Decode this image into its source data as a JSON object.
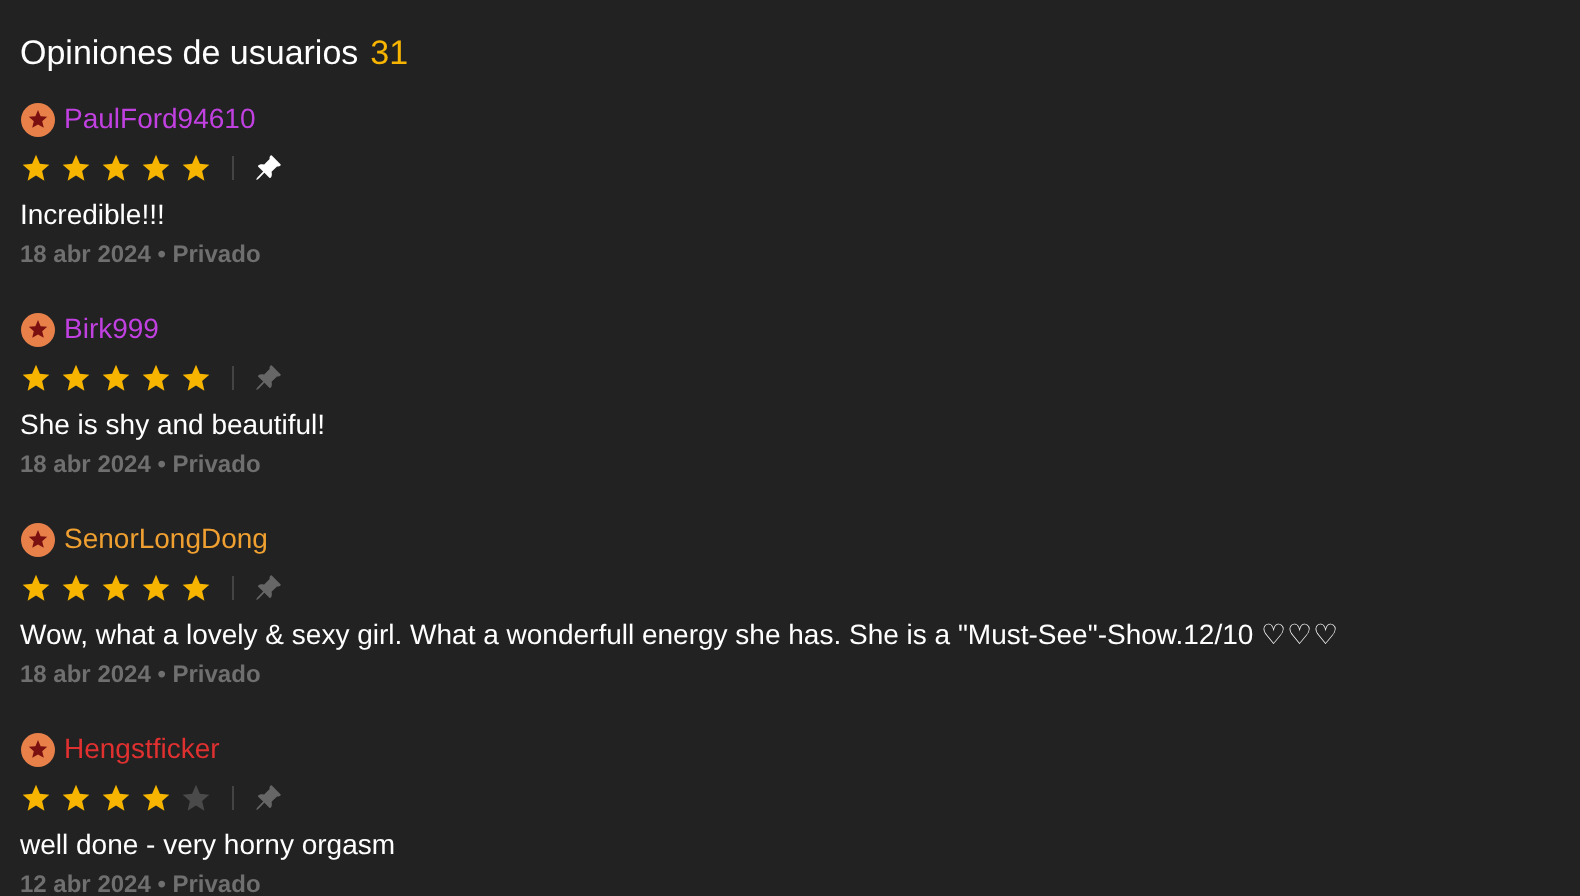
{
  "header": {
    "title": "Opiniones de usuarios",
    "count": "31"
  },
  "reviews": [
    {
      "user": "PaulFord94610",
      "color": "#c040e0",
      "stars": 5,
      "pinned": true,
      "text": "Incredible!!!",
      "meta": "18 abr 2024 • Privado"
    },
    {
      "user": "Birk999",
      "color": "#c040e0",
      "stars": 5,
      "pinned": false,
      "text": "She is shy and beautiful!",
      "meta": "18 abr 2024 • Privado"
    },
    {
      "user": "SenorLongDong",
      "color": "#f0a030",
      "stars": 5,
      "pinned": false,
      "text": "Wow, what a lovely & sexy girl. What a wonderfull energy she has. She is a \"Must-See\"-Show.12/10 ♡♡♡",
      "meta": "18 abr 2024 • Privado"
    },
    {
      "user": "Hengstficker",
      "color": "#e03030",
      "stars": 4,
      "pinned": false,
      "text": "well done - very horny orgasm",
      "meta": "12 abr 2024 • Privado"
    }
  ]
}
